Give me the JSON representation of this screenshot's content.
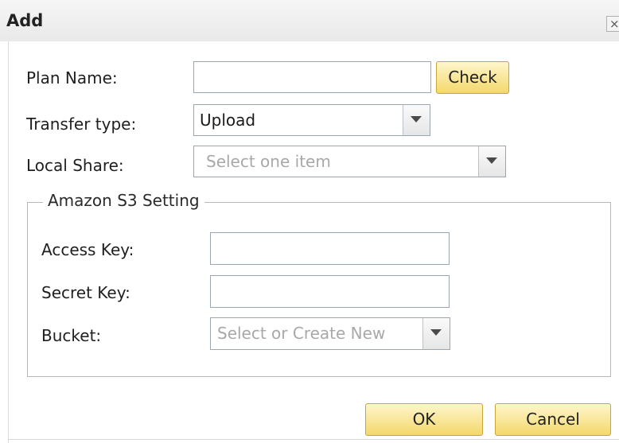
{
  "dialog": {
    "title": "Add",
    "close_glyph": "×"
  },
  "form": {
    "plan_name": {
      "label": "Plan Name:",
      "value": "",
      "check_label": "Check"
    },
    "transfer_type": {
      "label": "Transfer type:",
      "value": "Upload"
    },
    "local_share": {
      "label": "Local Share:",
      "placeholder": "Select one item"
    }
  },
  "s3": {
    "legend": "Amazon S3 Setting",
    "access_key": {
      "label": "Access Key:",
      "value": ""
    },
    "secret_key": {
      "label": "Secret Key:",
      "value": ""
    },
    "bucket": {
      "label": "Bucket:",
      "placeholder": "Select or Create New"
    }
  },
  "footer": {
    "ok_label": "OK",
    "cancel_label": "Cancel"
  }
}
